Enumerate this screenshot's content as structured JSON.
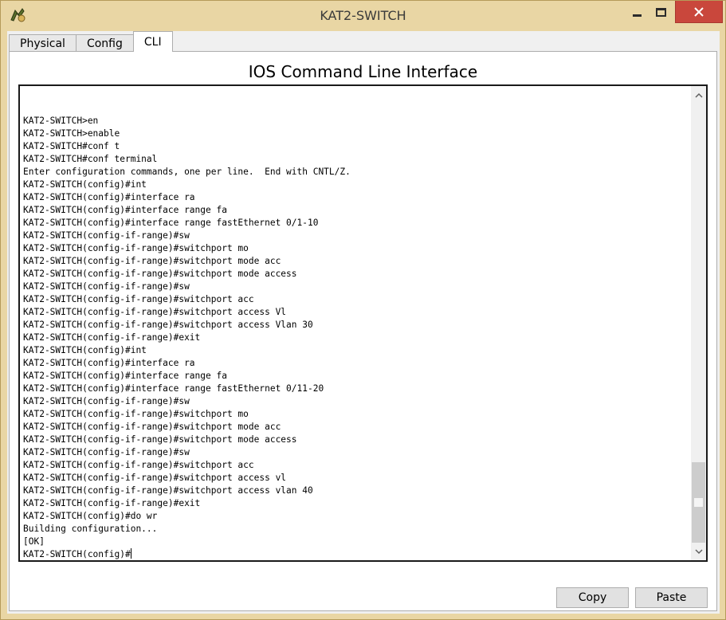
{
  "window": {
    "title": "KAT2-SWITCH",
    "accent_color": "#e9d6a4",
    "close_color": "#c9473c"
  },
  "window_controls": {
    "minimize_icon": "minimize-icon",
    "maximize_icon": "maximize-icon",
    "close_icon": "close-icon"
  },
  "tabs": [
    {
      "label": "Physical",
      "active": false
    },
    {
      "label": "Config",
      "active": false
    },
    {
      "label": "CLI",
      "active": true
    }
  ],
  "cli": {
    "heading": "IOS Command Line Interface",
    "terminal_text": "KAT2-SWITCH>en\nKAT2-SWITCH>enable\nKAT2-SWITCH#conf t\nKAT2-SWITCH#conf terminal\nEnter configuration commands, one per line.  End with CNTL/Z.\nKAT2-SWITCH(config)#int\nKAT2-SWITCH(config)#interface ra\nKAT2-SWITCH(config)#interface range fa\nKAT2-SWITCH(config)#interface range fastEthernet 0/1-10\nKAT2-SWITCH(config-if-range)#sw\nKAT2-SWITCH(config-if-range)#switchport mo\nKAT2-SWITCH(config-if-range)#switchport mode acc\nKAT2-SWITCH(config-if-range)#switchport mode access\nKAT2-SWITCH(config-if-range)#sw\nKAT2-SWITCH(config-if-range)#switchport acc\nKAT2-SWITCH(config-if-range)#switchport access Vl\nKAT2-SWITCH(config-if-range)#switchport access Vlan 30\nKAT2-SWITCH(config-if-range)#exit\nKAT2-SWITCH(config)#int\nKAT2-SWITCH(config)#interface ra\nKAT2-SWITCH(config)#interface range fa\nKAT2-SWITCH(config)#interface range fastEthernet 0/11-20\nKAT2-SWITCH(config-if-range)#sw\nKAT2-SWITCH(config-if-range)#switchport mo\nKAT2-SWITCH(config-if-range)#switchport mode acc\nKAT2-SWITCH(config-if-range)#switchport mode access\nKAT2-SWITCH(config-if-range)#sw\nKAT2-SWITCH(config-if-range)#switchport acc\nKAT2-SWITCH(config-if-range)#switchport access vl\nKAT2-SWITCH(config-if-range)#switchport access vlan 40\nKAT2-SWITCH(config-if-range)#exit\nKAT2-SWITCH(config)#do wr\nBuilding configuration...\n[OK]\nKAT2-SWITCH(config)#",
    "scroll_up_icon": "chevron-up-icon",
    "scroll_down_icon": "chevron-down-icon"
  },
  "buttons": {
    "copy_label": "Copy",
    "paste_label": "Paste"
  }
}
